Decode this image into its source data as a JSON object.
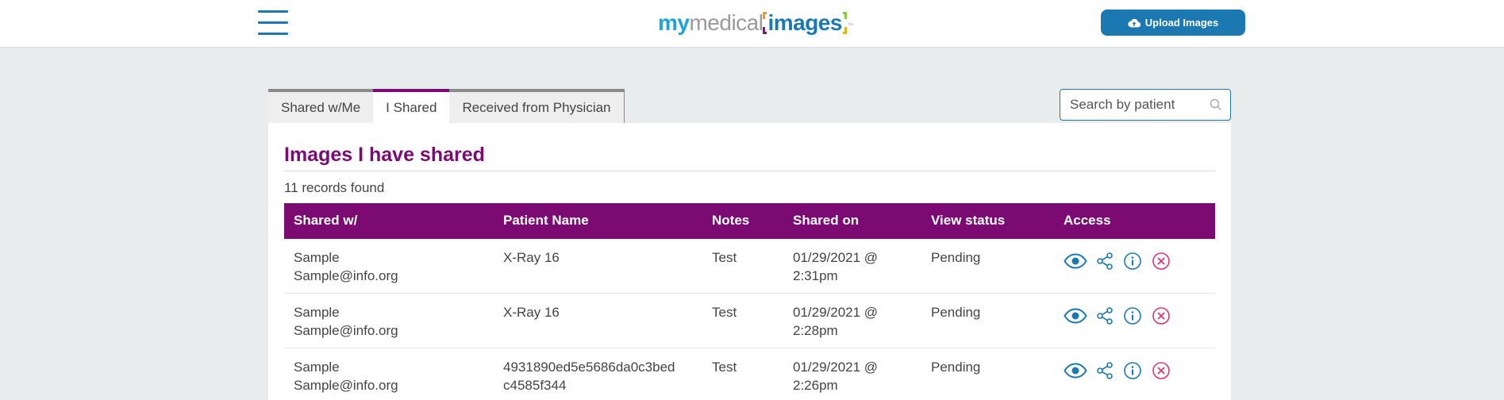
{
  "header": {
    "logo": {
      "part1": "my",
      "part2": "medical",
      "part3": "images",
      "tm": "™"
    },
    "upload_button": "Upload Images"
  },
  "tabs": [
    {
      "label": "Shared w/Me",
      "active": false
    },
    {
      "label": "I Shared",
      "active": true
    },
    {
      "label": "Received from Physician",
      "active": false
    }
  ],
  "search": {
    "placeholder": "Search by patient"
  },
  "panel": {
    "title": "Images I have shared",
    "records_found": "11 records found"
  },
  "table": {
    "columns": [
      "Shared w/",
      "Patient Name",
      "Notes",
      "Shared on",
      "View status",
      "Access"
    ],
    "rows": [
      {
        "shared_with_name": "Sample",
        "shared_with_email": "Sample@info.org",
        "patient_line1": "X-Ray 16",
        "patient_line2": "",
        "notes": "Test",
        "date_line1": "01/29/2021 @",
        "date_line2": "2:31pm",
        "status": "Pending"
      },
      {
        "shared_with_name": "Sample",
        "shared_with_email": "Sample@info.org",
        "patient_line1": "X-Ray 16",
        "patient_line2": "",
        "notes": "Test",
        "date_line1": "01/29/2021 @",
        "date_line2": "2:28pm",
        "status": "Pending"
      },
      {
        "shared_with_name": "Sample",
        "shared_with_email": "Sample@info.org",
        "patient_line1": "4931890ed5e5686da0c3bed",
        "patient_line2": "c4585f344",
        "notes": "Test",
        "date_line1": "01/29/2021 @",
        "date_line2": "2:26pm",
        "status": "Pending"
      }
    ]
  },
  "icons": {
    "menu": "hamburger-menu-icon",
    "upload": "cloud-upload-icon",
    "search": "search-icon",
    "view": "eye-icon",
    "share": "share-icon",
    "info": "info-icon",
    "delete": "close-circle-icon"
  },
  "colors": {
    "brand_blue": "#1b78b0",
    "brand_purple": "#7b0b73",
    "delete_red": "#e0356a",
    "background": "#e8eced"
  }
}
